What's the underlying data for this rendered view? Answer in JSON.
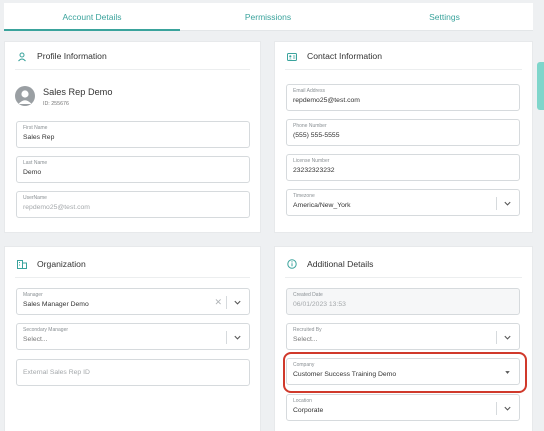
{
  "tabs": [
    {
      "label": "Account Details",
      "active": true
    },
    {
      "label": "Permissions",
      "active": false
    },
    {
      "label": "Settings",
      "active": false
    }
  ],
  "profile": {
    "title": "Profile Information",
    "icon": "user-icon",
    "name": "Sales Rep Demo",
    "id_text": "ID: 255676",
    "first_name": {
      "label": "First Name",
      "value": "Sales Rep"
    },
    "last_name": {
      "label": "Last Name",
      "value": "Demo"
    },
    "username": {
      "label": "UserName",
      "value": "repdemo25@test.com"
    }
  },
  "contact": {
    "title": "Contact Information",
    "icon": "contact-card-icon",
    "email": {
      "label": "Email Address",
      "value": "repdemo25@test.com"
    },
    "phone": {
      "label": "Phone Number",
      "value": "(555) 555-5555"
    },
    "license": {
      "label": "License Number",
      "value": "23232323232"
    },
    "timezone": {
      "label": "Timezone",
      "value": "America/New_York"
    }
  },
  "organization": {
    "title": "Organization",
    "icon": "building-icon",
    "manager": {
      "label": "Manager",
      "value": "Sales Manager Demo"
    },
    "secondary_manager": {
      "label": "Secondary Manager",
      "value": "Select..."
    },
    "external_id": {
      "placeholder": "External Sales Rep ID"
    }
  },
  "additional": {
    "title": "Additional Details",
    "icon": "info-circle-icon",
    "created_date": {
      "label": "Created Date",
      "value": "06/01/2023 13:53"
    },
    "recruited_by": {
      "label": "Recruited By",
      "value": "Select..."
    },
    "company": {
      "label": "Company",
      "value": "Customer Success Training Demo"
    },
    "location": {
      "label": "Location",
      "value": "Corporate"
    }
  },
  "colors": {
    "accent": "#3aa39c",
    "highlight": "#d0392b",
    "avatar": "#9a9fa3"
  }
}
